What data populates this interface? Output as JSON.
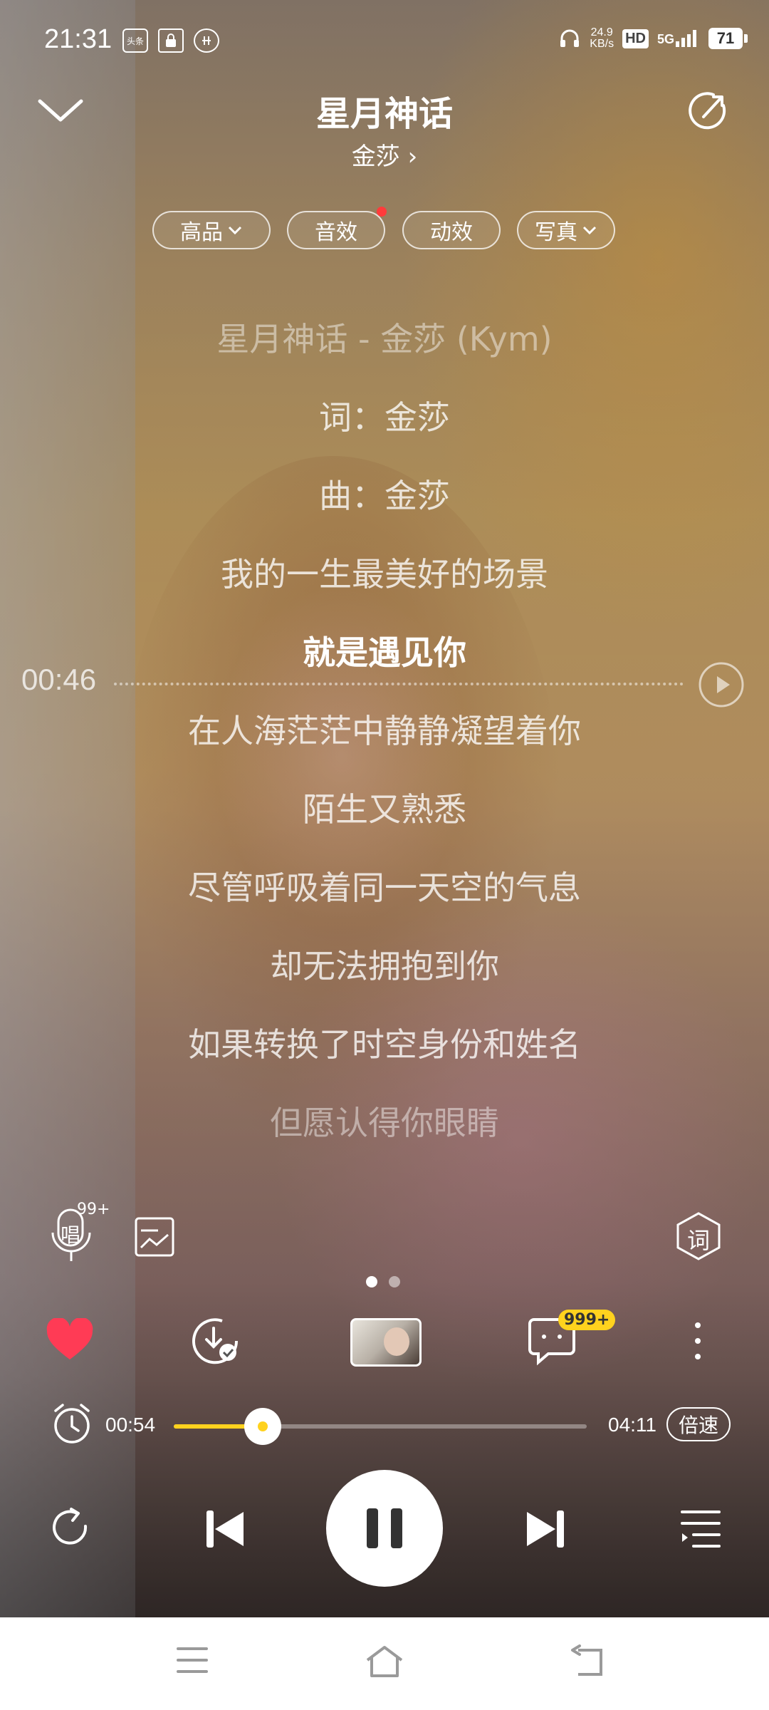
{
  "status_bar": {
    "time": "21:31",
    "left_icons": [
      "toutiao-icon",
      "lock-icon",
      "sim-icon"
    ],
    "left_badge_text": "头条",
    "speed_value": "24.9",
    "speed_unit": "KB/s",
    "hd": "HD",
    "network": "5G",
    "battery": "71"
  },
  "header": {
    "title": "星月神话",
    "artist": "金莎",
    "artist_chevron": "›"
  },
  "chips": [
    {
      "label": "高品",
      "dropdown": true
    },
    {
      "label": "音效",
      "dot": true
    },
    {
      "label": "动效"
    },
    {
      "label": "写真",
      "dropdown": true
    }
  ],
  "lyrics": {
    "lines": [
      "星月神话  -  金莎  (Kym)",
      "词：金莎",
      "曲：金莎",
      "我的一生最美好的场景",
      "就是遇见你",
      "在人海茫茫中静静凝望着你",
      "陌生又熟悉",
      "尽管呼吸着同一天空的气息",
      "却无法拥抱到你",
      "如果转换了时空身份和姓名",
      "但愿认得你眼睛"
    ],
    "current_index": 4,
    "seek_time": "00:46"
  },
  "tools": {
    "sing_label": "唱",
    "sing_badge": "99+",
    "lyrics_button": "词"
  },
  "actions": {
    "comment_badge": "999+"
  },
  "progress": {
    "current": "00:54",
    "total": "04:11",
    "fraction": 0.215,
    "speed_label": "倍速"
  },
  "colors": {
    "accent": "#ffd21e",
    "like": "#ff3b55",
    "dot": "#ff3b3b"
  }
}
